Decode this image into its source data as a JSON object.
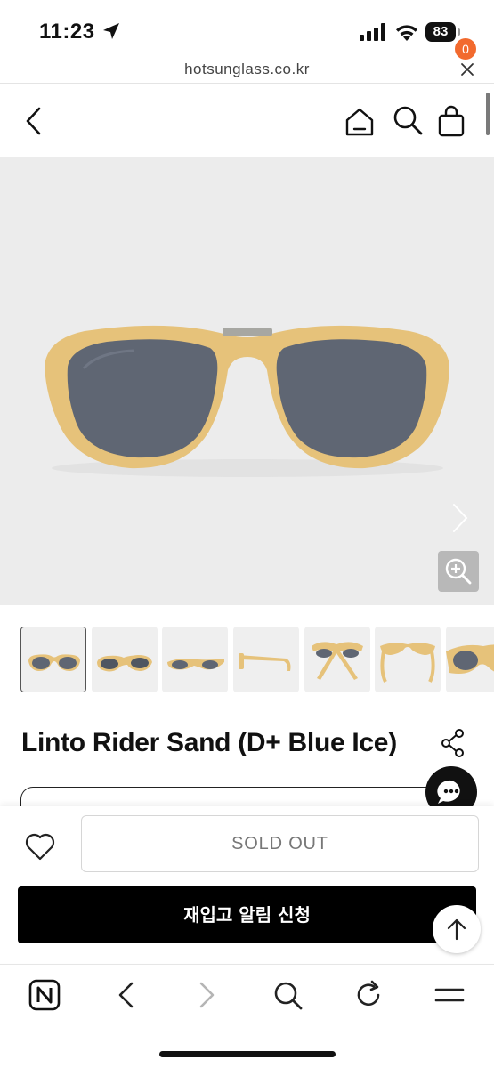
{
  "status_bar": {
    "time": "11:23",
    "battery": "83",
    "icons": [
      "location-arrow-icon",
      "cellular-signal-icon",
      "wifi-icon",
      "battery-icon"
    ]
  },
  "browser": {
    "url": "hotsunglass.co.kr",
    "close_icon": "close-icon"
  },
  "header": {
    "icons": [
      "back-icon",
      "home-icon",
      "search-icon",
      "cart-icon"
    ],
    "cart_count": "0",
    "accent_color": "#f26a2e"
  },
  "product": {
    "title": "Linto Rider Sand (D+ Blue Ice)",
    "frame_color": "#e6c27a",
    "lens_color": "#5f6673",
    "thumbnail_count": 7,
    "active_thumbnail": 1
  },
  "purchase": {
    "soldout_label": "SOLD OUT",
    "restock_label": "재입고 알림 신청"
  },
  "toolbar": {
    "icons": [
      "naver-n-icon",
      "back-icon",
      "forward-icon",
      "search-icon",
      "reload-icon",
      "menu-icon"
    ]
  }
}
